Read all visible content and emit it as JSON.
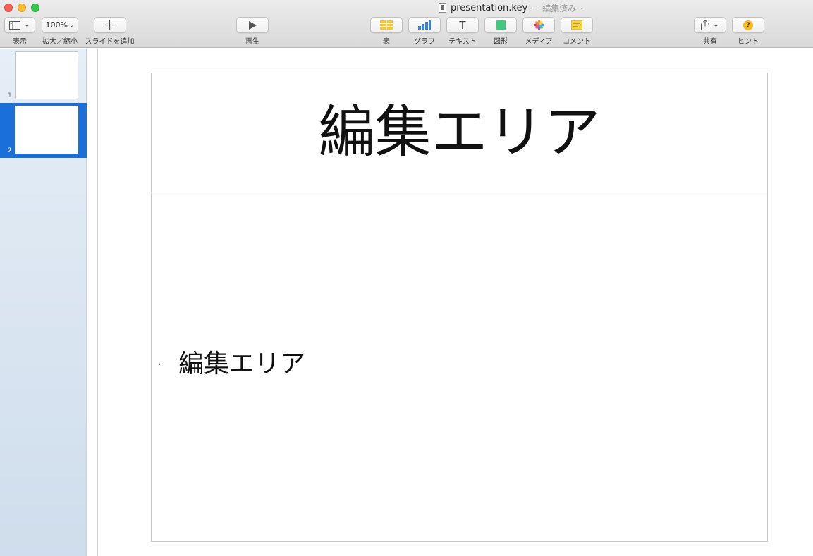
{
  "window": {
    "filename": "presentation.key",
    "separator": "—",
    "status": "編集済み",
    "status_chevron": "⌄"
  },
  "toolbar": {
    "view": {
      "label": "表示",
      "chevron": "⌄"
    },
    "zoom": {
      "value": "100%",
      "chevron": "⌄",
      "label": "拡大／縮小"
    },
    "add_slide": {
      "symbol": "＋",
      "label": "スライドを追加"
    },
    "play": {
      "symbol": "▶",
      "label": "再生"
    },
    "table": {
      "label": "表"
    },
    "chart": {
      "label": "グラフ"
    },
    "text": {
      "symbol": "T",
      "label": "テキスト"
    },
    "shape": {
      "label": "図形"
    },
    "media": {
      "label": "メディア"
    },
    "comment": {
      "label": "コメント"
    },
    "share": {
      "chevron": "⌄",
      "label": "共有"
    },
    "tips": {
      "symbol": "?",
      "label": "ヒント"
    }
  },
  "icons": {
    "view": "sidebar-view-icon",
    "add": "plus-icon",
    "play": "play-icon",
    "table": "table-icon",
    "chart": "bar-chart-icon",
    "text": "text-icon",
    "shape": "shape-icon",
    "media": "photos-icon",
    "comment": "comment-icon",
    "share": "share-icon",
    "tips": "help-icon"
  },
  "colors": {
    "selection": "#1a6fd8",
    "table_icon": "#f7c531",
    "chart_icon": "#3a86d4",
    "shape_icon": "#3fc97a",
    "comment_icon": "#f7d23b",
    "tips_icon": "#f6b824"
  },
  "sidebar": {
    "slides": [
      {
        "number": "1",
        "selected": false
      },
      {
        "number": "2",
        "selected": true
      }
    ]
  },
  "slide": {
    "title": "編集エリア",
    "bullet": "·",
    "body": "編集エリア"
  }
}
